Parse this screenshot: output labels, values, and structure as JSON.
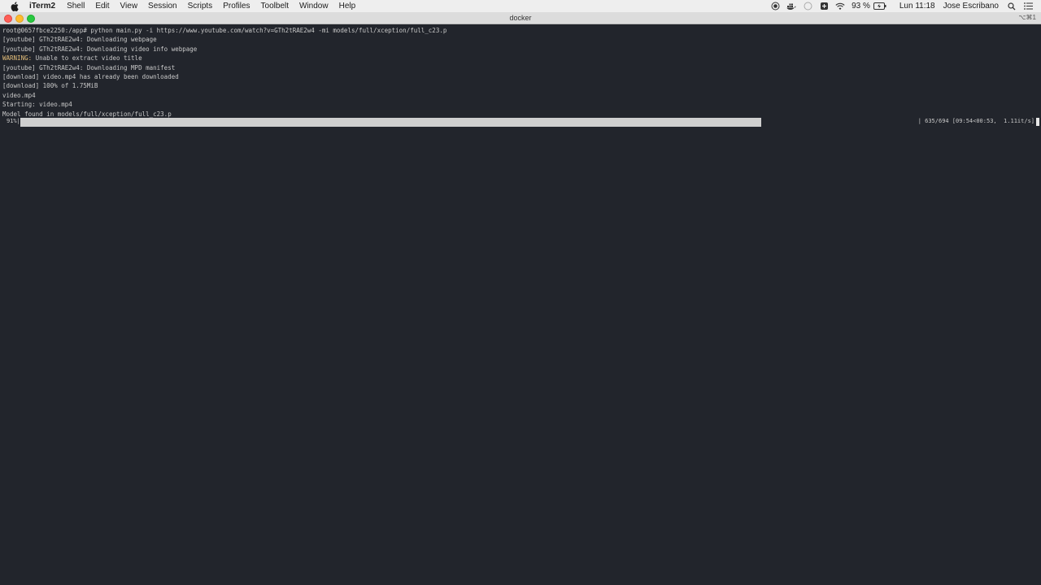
{
  "menubar": {
    "app_name": "iTerm2",
    "items": [
      "Shell",
      "Edit",
      "View",
      "Session",
      "Scripts",
      "Profiles",
      "Toolbelt",
      "Window",
      "Help"
    ],
    "battery_text": "93 %",
    "datetime": "Lun 11:18",
    "user": "Jose Escribano"
  },
  "window": {
    "title": "docker",
    "shortcut": "⌥⌘1"
  },
  "terminal": {
    "lines": [
      {
        "text": "root@0657fbce2250:/app# python main.py -i https://www.youtube.com/watch?v=GTh2tRAE2w4 -mi models/full/xception/full_c23.p"
      },
      {
        "text": "[youtube] GTh2tRAE2w4: Downloading webpage"
      },
      {
        "text": "[youtube] GTh2tRAE2w4: Downloading video info webpage"
      },
      {
        "prefix": "WARNING:",
        "text": " Unable to extract video title"
      },
      {
        "text": "[youtube] GTh2tRAE2w4: Downloading MPD manifest"
      },
      {
        "text": "[download] video.mp4 has already been downloaded"
      },
      {
        "text": "[download] 100% of 1.75MiB"
      },
      {
        "text": "video.mp4"
      },
      {
        "text": "Starting: video.mp4"
      },
      {
        "text": "Model found in models/full/xception/full_c23.p"
      }
    ],
    "progress": {
      "percent_label": "91%|",
      "fraction": 0.915,
      "stats": "| 635/694 [09:54<00:53,  1.11it/s]"
    }
  }
}
